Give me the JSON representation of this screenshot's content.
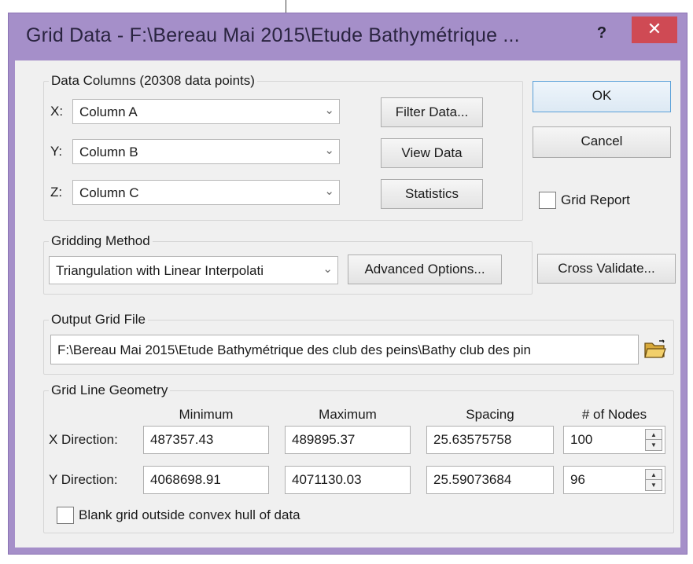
{
  "window": {
    "title": "Grid Data - F:\\Bereau Mai 2015\\Etude Bathymétrique ...",
    "help_label": "?",
    "close_label": "✕"
  },
  "data_columns": {
    "title": "Data Columns    (20308 data points)",
    "x_label": "X:",
    "x_value": "Column A",
    "y_label": "Y:",
    "y_value": "Column B",
    "z_label": "Z:",
    "z_value": "Column C",
    "filter_button": "Filter Data...",
    "view_button": "View Data",
    "statistics_button": "Statistics"
  },
  "actions": {
    "ok": "OK",
    "cancel": "Cancel",
    "grid_report_label": "Grid Report",
    "grid_report_checked": false
  },
  "gridding_method": {
    "title": "Gridding Method",
    "value": "Triangulation with Linear Interpolati",
    "advanced_button": "Advanced Options...",
    "cross_validate_button": "Cross Validate..."
  },
  "output_grid_file": {
    "title": "Output Grid File",
    "value": "F:\\Bereau Mai 2015\\Etude Bathymétrique des club des peins\\Bathy club des pin"
  },
  "grid_line_geometry": {
    "title": "Grid Line Geometry",
    "headers": {
      "minimum": "Minimum",
      "maximum": "Maximum",
      "spacing": "Spacing",
      "nodes": "# of Nodes"
    },
    "x": {
      "label": "X Direction:",
      "minimum": "487357.43",
      "maximum": "489895.37",
      "spacing": "25.63575758",
      "nodes": "100"
    },
    "y": {
      "label": "Y Direction:",
      "minimum": "4068698.91",
      "maximum": "4071130.03",
      "spacing": "25.59073684",
      "nodes": "96"
    },
    "blank_outside_label": "Blank grid outside convex hull of data",
    "blank_outside_checked": false
  },
  "icons": {
    "dropdown": "chevron-down-icon",
    "folder": "open-folder-icon",
    "spin_up": "spin-up-icon",
    "spin_down": "spin-down-icon"
  },
  "colors": {
    "title_bar": "#a58fc9",
    "close_button": "#cf4a54",
    "dialog_background": "#f0f0f0"
  }
}
